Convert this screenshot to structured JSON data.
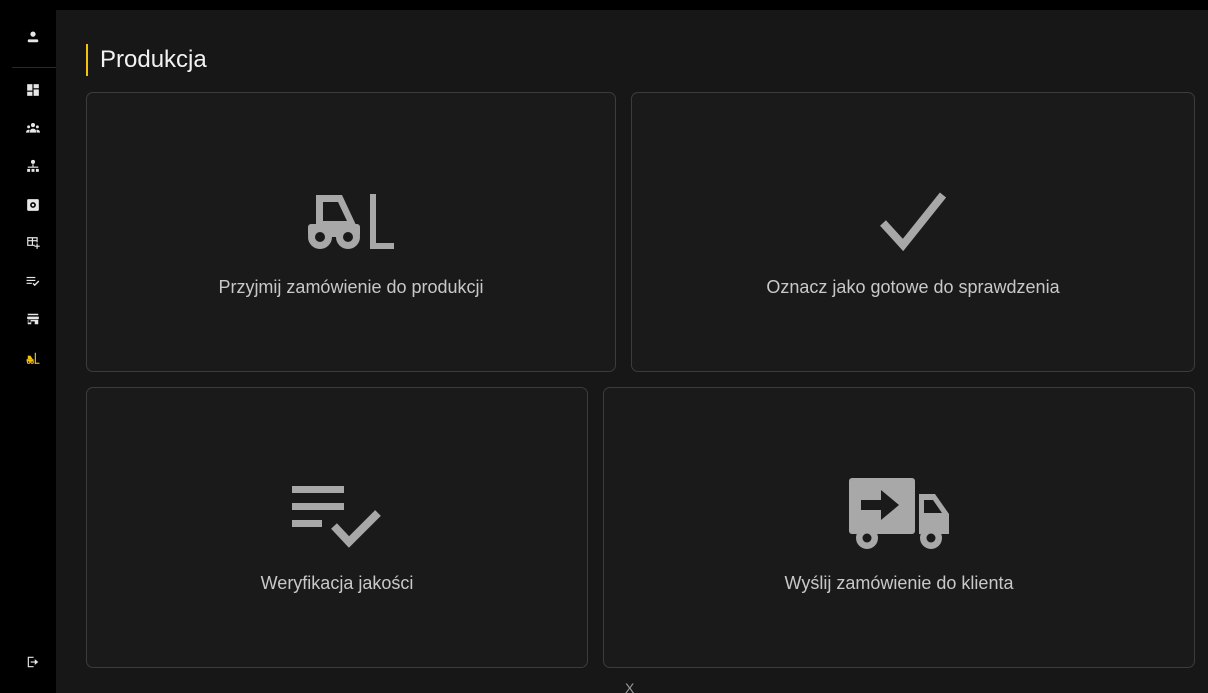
{
  "page": {
    "title": "Produkcja",
    "footer_mark": "X"
  },
  "colors": {
    "accent": "#f4c20d",
    "sidebar_icon": "#e6e6e6",
    "card_icon": "#a8a8a8",
    "card_text": "#c8c8c8",
    "card_border": "#3c3c3c",
    "background": "#171717"
  },
  "sidebar": {
    "items": [
      {
        "icon": "person-icon",
        "active": false
      },
      {
        "icon": "dashboard-icon",
        "active": false
      },
      {
        "icon": "groups-icon",
        "active": false
      },
      {
        "icon": "org-chart-icon",
        "active": false
      },
      {
        "icon": "settings-box-icon",
        "active": false
      },
      {
        "icon": "table-add-icon",
        "active": false
      },
      {
        "icon": "checklist-icon",
        "active": false
      },
      {
        "icon": "store-icon",
        "active": false
      },
      {
        "icon": "forklift-icon",
        "active": true
      }
    ],
    "logout_icon": "logout-icon"
  },
  "cards": [
    {
      "icon": "forklift-icon",
      "label": "Przyjmij zamówienie do produkcji"
    },
    {
      "icon": "check-icon",
      "label": "Oznacz jako gotowe do sprawdzenia"
    },
    {
      "icon": "checklist-icon",
      "label": "Weryfikacja jakości"
    },
    {
      "icon": "shipping-truck-icon",
      "label": "Wyślij zamówienie do klienta"
    }
  ]
}
